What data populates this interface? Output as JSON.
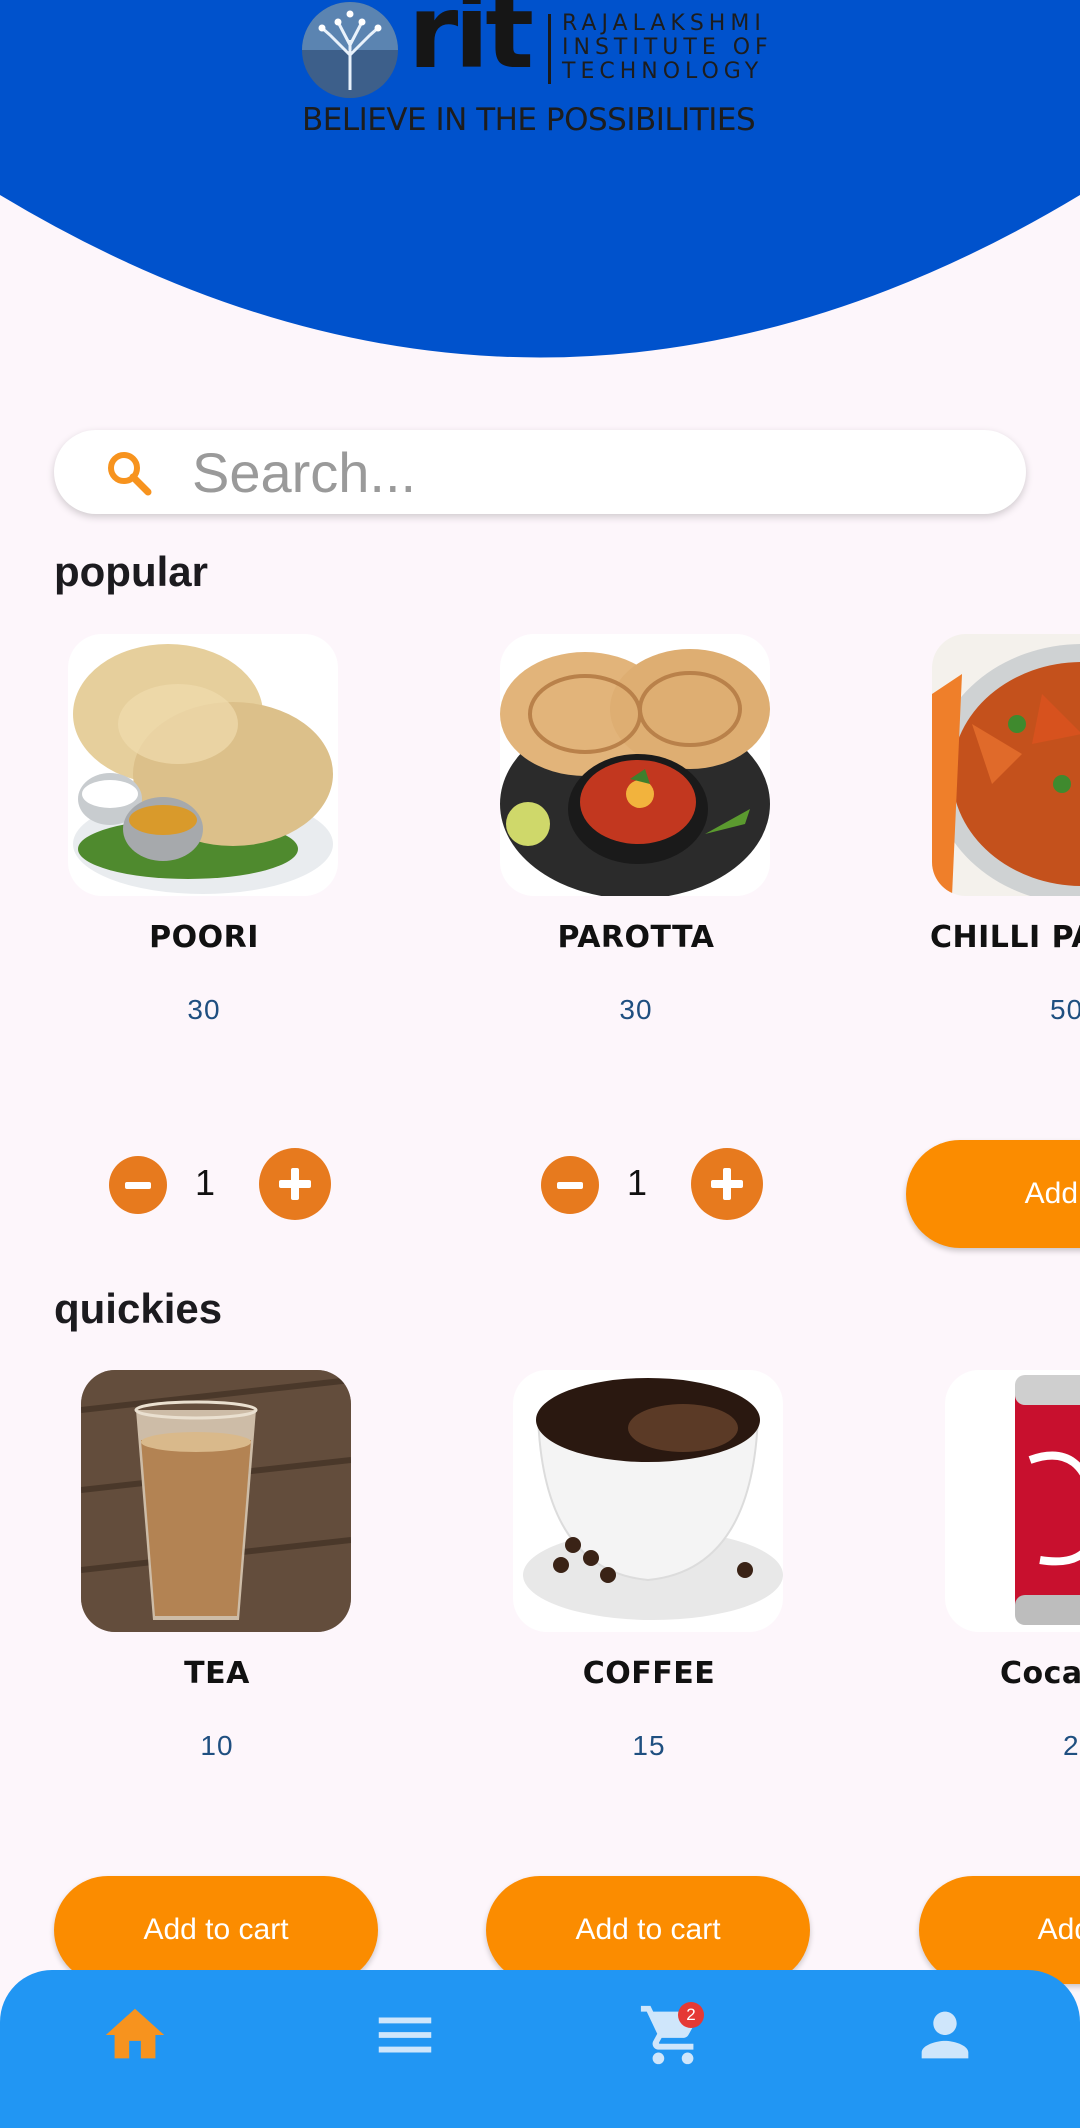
{
  "header": {
    "logo_wordmark": "rit",
    "institute_name": [
      "RAJALAKSHMI",
      "INSTITUTE OF",
      "TECHNOLOGY"
    ],
    "tagline": "BELIEVE IN THE POSSIBILITIES"
  },
  "search": {
    "placeholder": "Search..."
  },
  "sections": [
    {
      "title": "popular",
      "items": [
        {
          "name": "POORI",
          "price": "30",
          "quantity": "1",
          "image": "poori-image"
        },
        {
          "name": "PAROTTA",
          "price": "30",
          "quantity": "1",
          "image": "parotta-image"
        },
        {
          "name": "CHILLI PA",
          "price": "50",
          "button": "Add to",
          "image": "chilli-image"
        }
      ]
    },
    {
      "title": "quickies",
      "items": [
        {
          "name": "TEA",
          "price": "10",
          "button": "Add to cart",
          "image": "tea-image"
        },
        {
          "name": "COFFEE",
          "price": "15",
          "button": "Add to cart",
          "image": "coffee-image"
        },
        {
          "name": "Coca",
          "price": "2",
          "button": "Add to",
          "image": "cola-image"
        }
      ]
    }
  ],
  "bottom_nav": {
    "items": [
      "home-icon",
      "menu-icon",
      "cart-icon",
      "profile-icon"
    ],
    "cart_badge": "2",
    "active_color": "#f7931e",
    "icon_color": "#cfe6fb"
  },
  "colors": {
    "header_blue": "#0052cc",
    "accent_orange": "#fb8c00",
    "nav_blue": "#2196f3"
  }
}
